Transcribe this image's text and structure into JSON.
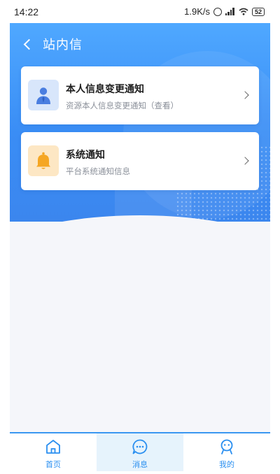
{
  "status_bar": {
    "time": "14:22",
    "network_speed": "1.9K/s",
    "battery": "52",
    "icons": [
      "alarm-icon",
      "signal-icon",
      "wifi-icon",
      "battery-icon"
    ]
  },
  "header": {
    "title": "站内信",
    "back_icon": "chevron-left-icon"
  },
  "notifications": [
    {
      "icon": "person-icon",
      "title": "本人信息变更通知",
      "subtitle": "资源本人信息变更通知（查看）"
    },
    {
      "icon": "bell-icon",
      "title": "系统通知",
      "subtitle": "平台系统通知信息"
    }
  ],
  "tabbar": {
    "active": "消息",
    "tabs": [
      {
        "label": "首页",
        "icon": "home-icon"
      },
      {
        "label": "消息",
        "icon": "chat-icon"
      },
      {
        "label": "我的",
        "icon": "profile-icon"
      }
    ]
  },
  "colors": {
    "accent": "#2a8ff0",
    "hero": "#3a8df5",
    "bell": "#f5a623",
    "person": "#4a7ee0"
  }
}
